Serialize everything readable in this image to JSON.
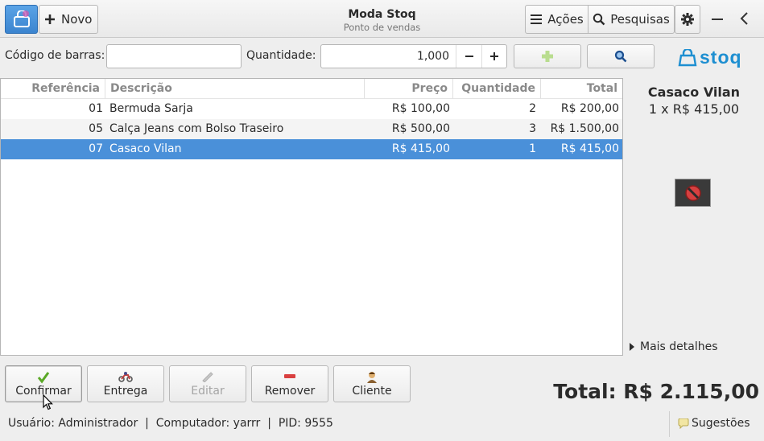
{
  "header": {
    "app_title": "Moda Stoq",
    "subtitle": "Ponto de vendas",
    "new_label": "Novo",
    "actions_label": "Ações",
    "search_label": "Pesquisas",
    "brand": "stoq",
    "accent": "#1e8fd1"
  },
  "toolbar": {
    "barcode_label": "Código de barras:",
    "barcode_value": "",
    "quantity_label": "Quantidade:",
    "quantity_value": "1,000"
  },
  "table": {
    "columns": [
      "Referência",
      "Descrição",
      "Preço",
      "Quantidade",
      "Total"
    ],
    "rows": [
      {
        "ref": "01",
        "desc": "Bermuda Sarja",
        "price": "R$ 100,00",
        "qty": "2",
        "total": "R$ 200,00"
      },
      {
        "ref": "05",
        "desc": "Calça Jeans com Bolso Traseiro",
        "price": "R$ 500,00",
        "qty": "3",
        "total": "R$ 1.500,00"
      },
      {
        "ref": "07",
        "desc": "Casaco Vilan",
        "price": "R$ 415,00",
        "qty": "1",
        "total": "R$ 415,00"
      }
    ],
    "selected_row": 2
  },
  "side": {
    "product_name": "Casaco Vilan",
    "product_qty_price": "1 x R$ 415,00",
    "more_details": "Mais detalhes"
  },
  "buttons": {
    "confirm": "Confirmar",
    "delivery": "Entrega",
    "edit": "Editar",
    "remove": "Remover",
    "client": "Cliente"
  },
  "total_label": "Total: R$ 2.115,00",
  "statusbar": {
    "info": "Usuário: Administrador  |  Computador: yarrr  |  PID: 9555",
    "suggestions": "Sugestões"
  }
}
